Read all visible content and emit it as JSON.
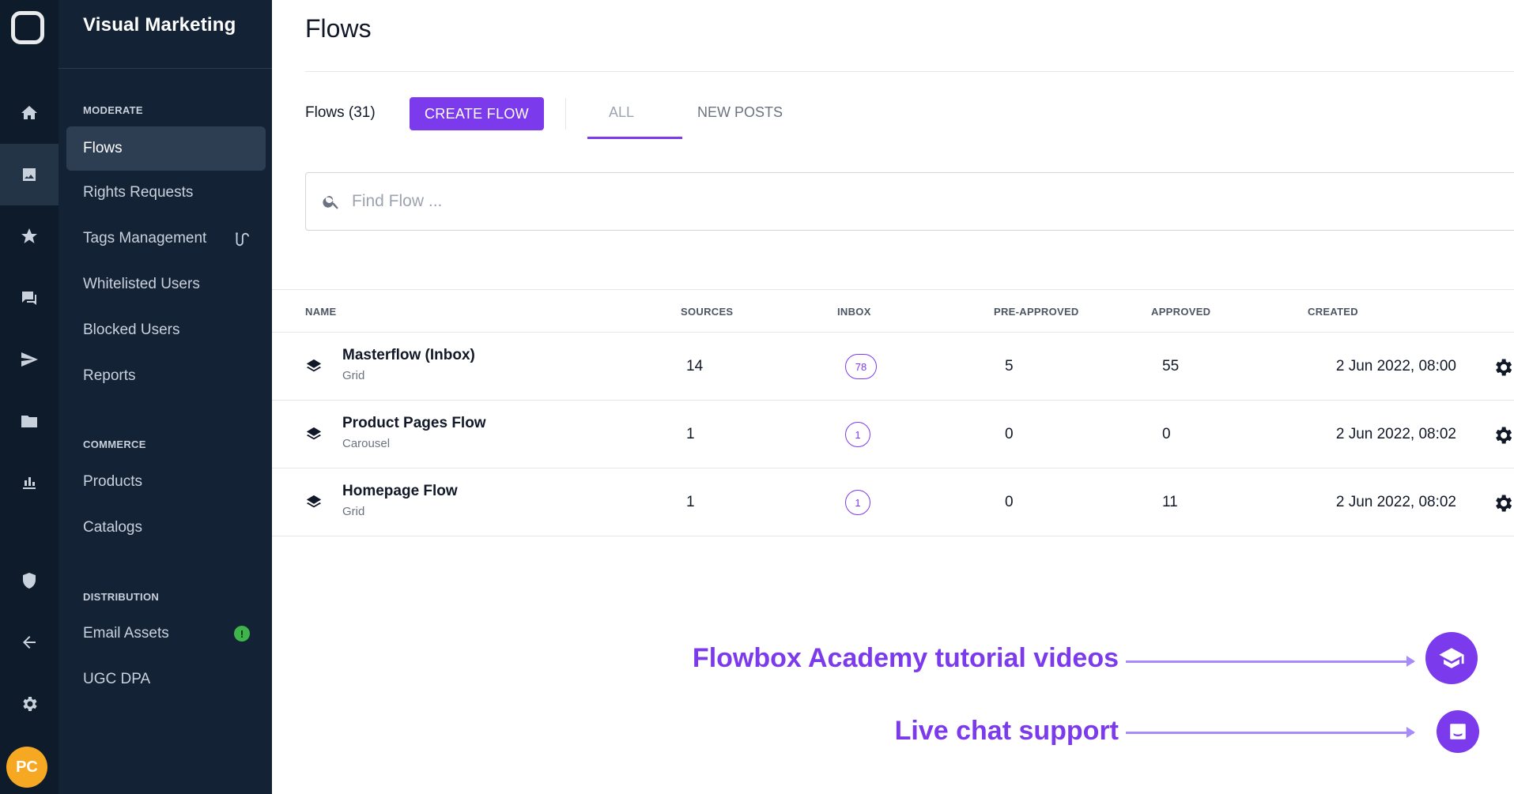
{
  "rail": {
    "items": [
      {
        "icon": "home-icon"
      },
      {
        "icon": "image-icon",
        "active": true
      },
      {
        "icon": "star-icon"
      },
      {
        "icon": "chat-icon"
      },
      {
        "icon": "send-icon"
      },
      {
        "icon": "folder-icon"
      },
      {
        "icon": "bar-chart-icon"
      },
      {
        "icon": "shield-icon"
      },
      {
        "icon": "back-arrow-icon"
      },
      {
        "icon": "gear-icon"
      }
    ],
    "avatar_initials": "PC"
  },
  "sidebar": {
    "brand": "Visual Marketing",
    "sections": {
      "moderate": "MODERATE",
      "commerce": "COMMERCE",
      "distribution": "DISTRIBUTION"
    },
    "items": {
      "flows": "Flows",
      "rights_requests": "Rights Requests",
      "tags_management": "Tags Management",
      "whitelisted_users": "Whitelisted Users",
      "blocked_users": "Blocked Users",
      "reports": "Reports",
      "products": "Products",
      "catalogs": "Catalogs",
      "email_assets": "Email Assets",
      "ugc_dpa": "UGC DPA"
    },
    "email_assets_badge": "!"
  },
  "main": {
    "title": "Flows",
    "count_label": "Flows (31)",
    "create_button": "CREATE FLOW",
    "tabs": {
      "all": "ALL",
      "new_posts": "NEW POSTS"
    },
    "search_placeholder": "Find Flow ...",
    "table": {
      "headers": {
        "name": "NAME",
        "sources": "SOURCES",
        "inbox": "INBOX",
        "pre_approved": "PRE-APPROVED",
        "approved": "APPROVED",
        "created": "CREATED"
      },
      "rows": [
        {
          "name": "Masterflow (Inbox)",
          "type": "Grid",
          "sources": "14",
          "inbox": "78",
          "pre_approved": "5",
          "approved": "55",
          "created": "2 Jun 2022, 08:00"
        },
        {
          "name": "Product Pages Flow",
          "type": "Carousel",
          "sources": "1",
          "inbox": "1",
          "pre_approved": "0",
          "approved": "0",
          "created": "2 Jun 2022, 08:02"
        },
        {
          "name": "Homepage Flow",
          "type": "Grid",
          "sources": "1",
          "inbox": "1",
          "pre_approved": "0",
          "approved": "11",
          "created": "2 Jun 2022, 08:02"
        }
      ]
    }
  },
  "promo": {
    "academy": "Flowbox Academy tutorial videos",
    "chat": "Live chat support"
  },
  "colors": {
    "accent": "#7c3aed",
    "rail_bg": "#0d1b2a",
    "sidebar_bg": "#132235",
    "avatar": "#f7a823",
    "badge_green": "#3db54a"
  }
}
